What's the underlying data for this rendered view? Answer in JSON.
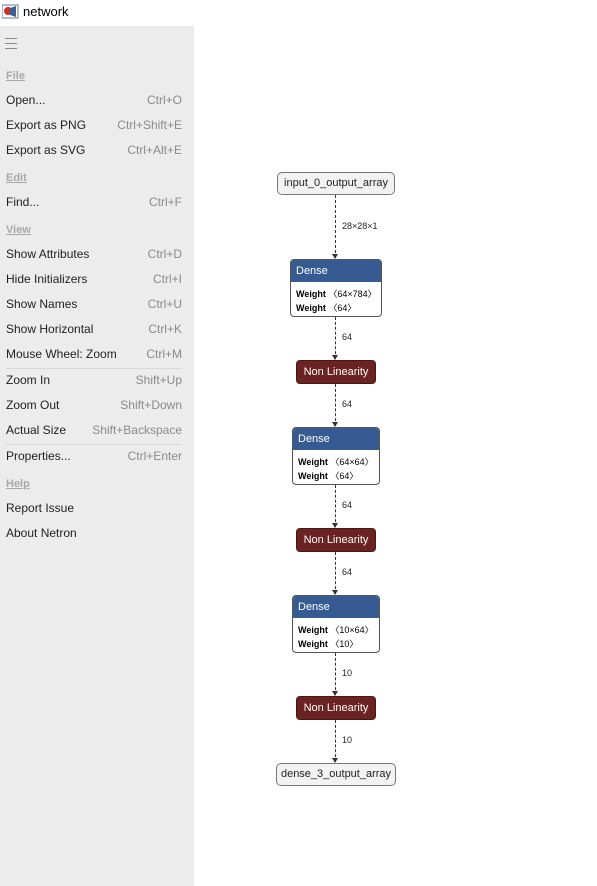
{
  "window": {
    "title": "network",
    "icon": "app-icon"
  },
  "menu": {
    "groups": [
      {
        "header": "File",
        "items": [
          {
            "label": "Open...",
            "shortcut": "Ctrl+O"
          },
          {
            "label": "Export as PNG",
            "shortcut": "Ctrl+Shift+E"
          },
          {
            "label": "Export as SVG",
            "shortcut": "Ctrl+Alt+E"
          }
        ]
      },
      {
        "header": "Edit",
        "items": [
          {
            "label": "Find...",
            "shortcut": "Ctrl+F"
          }
        ]
      },
      {
        "header": "View",
        "items": [
          {
            "label": "Show Attributes",
            "shortcut": "Ctrl+D"
          },
          {
            "label": "Hide Initializers",
            "shortcut": "Ctrl+I"
          },
          {
            "label": "Show Names",
            "shortcut": "Ctrl+U"
          },
          {
            "label": "Show Horizontal",
            "shortcut": "Ctrl+K"
          },
          {
            "label": "Mouse Wheel: Zoom",
            "shortcut": "Ctrl+M"
          },
          {
            "label": "Zoom In",
            "shortcut": "Shift+Up"
          },
          {
            "label": "Zoom Out",
            "shortcut": "Shift+Down"
          },
          {
            "label": "Actual Size",
            "shortcut": "Shift+Backspace"
          },
          {
            "label": "Properties...",
            "shortcut": "Ctrl+Enter"
          }
        ]
      },
      {
        "header": "Help",
        "items": [
          {
            "label": "Report Issue",
            "shortcut": ""
          },
          {
            "label": "About Netron",
            "shortcut": ""
          }
        ]
      }
    ]
  },
  "graph": {
    "input": "input_0_output_array",
    "output": "dense_3_output_array",
    "edges": [
      "28×28×1",
      "64",
      "64",
      "64",
      "64",
      "10",
      "10"
    ],
    "dense": [
      {
        "title": "Dense",
        "weights": [
          {
            "name": "Weight",
            "shape": "〈64×784〉"
          },
          {
            "name": "Weight",
            "shape": "〈64〉"
          }
        ]
      },
      {
        "title": "Dense",
        "weights": [
          {
            "name": "Weight",
            "shape": "〈64×64〉"
          },
          {
            "name": "Weight",
            "shape": "〈64〉"
          }
        ]
      },
      {
        "title": "Dense",
        "weights": [
          {
            "name": "Weight",
            "shape": "〈10×64〉"
          },
          {
            "name": "Weight",
            "shape": "〈10〉"
          }
        ]
      }
    ],
    "nonlin": [
      "Non Linearity",
      "Non Linearity",
      "Non Linearity"
    ]
  },
  "colors": {
    "dense_header": "#365a92",
    "nonlinearity": "#6a2320",
    "sidebar": "#ececec"
  }
}
